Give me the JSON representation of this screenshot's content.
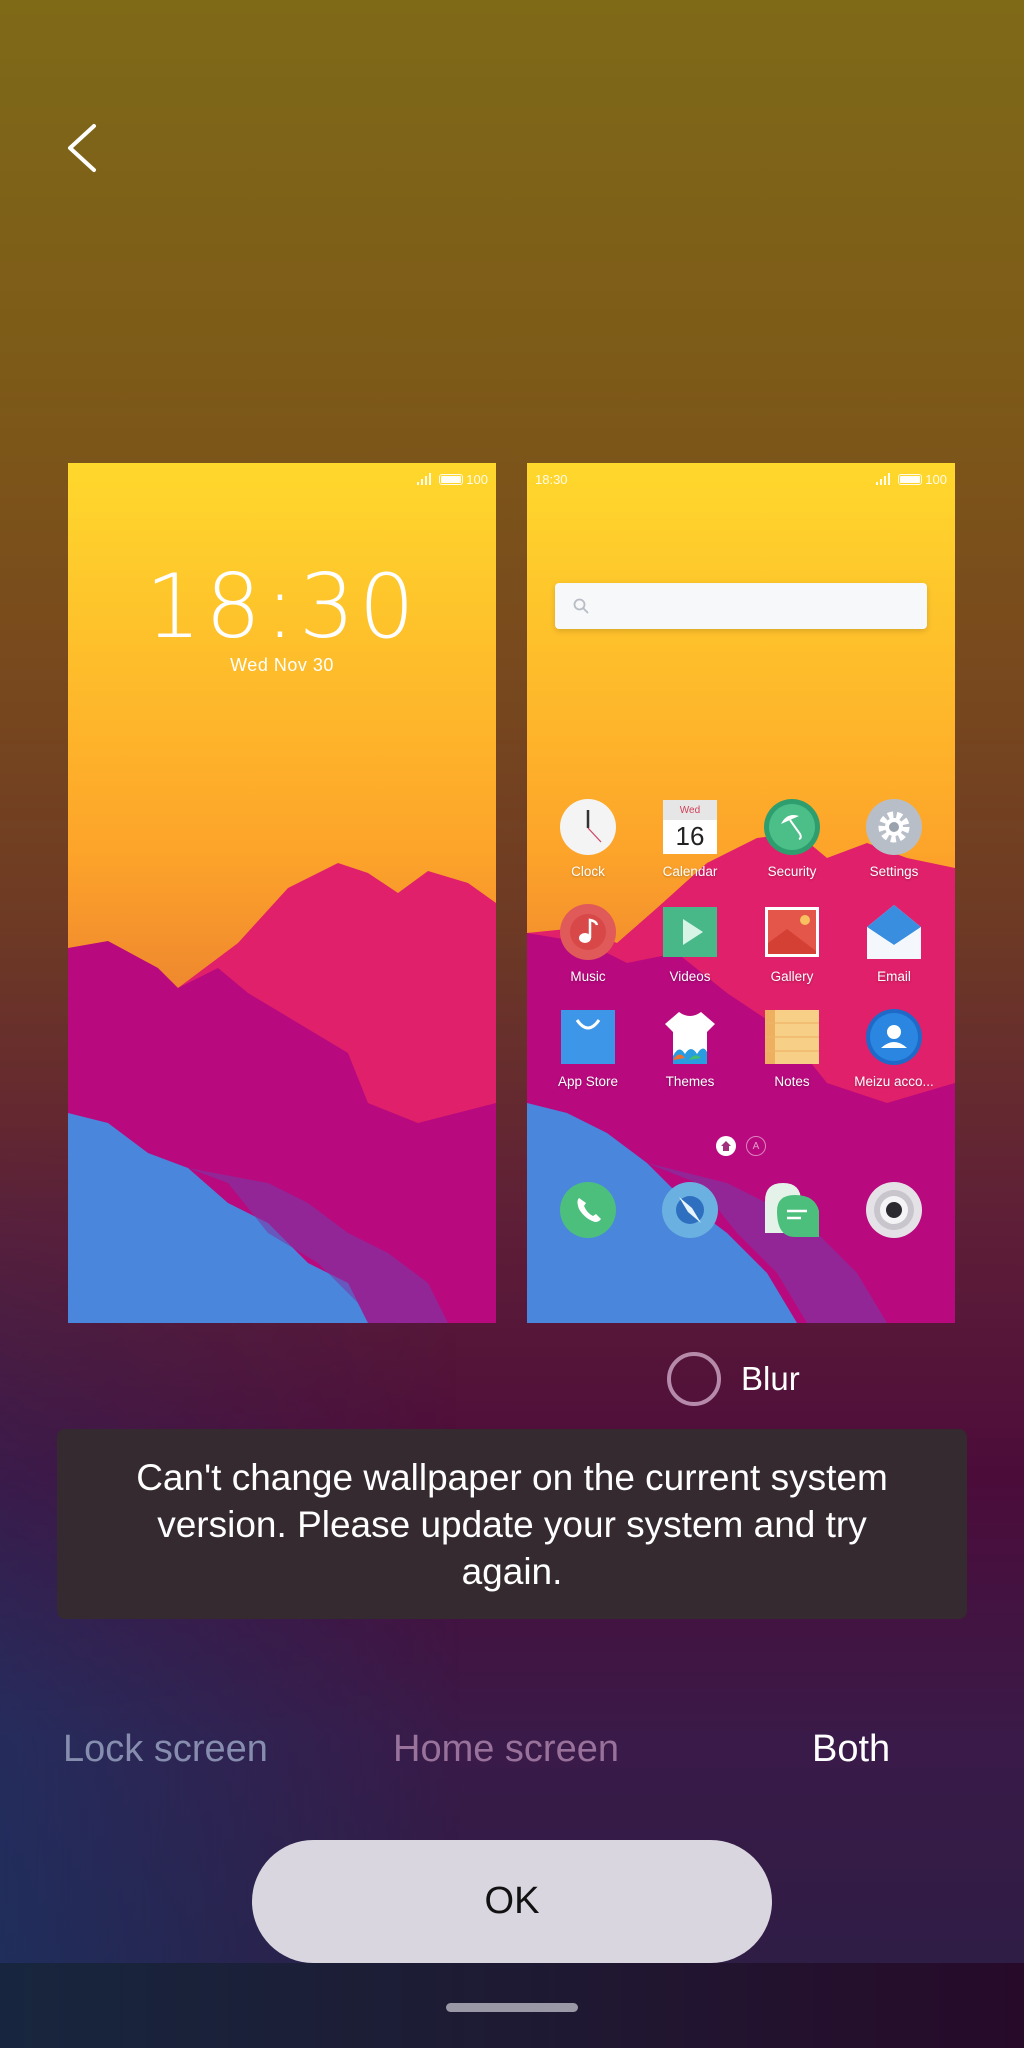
{
  "header": {
    "back_icon": "chevron-left-icon"
  },
  "lock_preview": {
    "status": {
      "signal_icon": "signal-icon",
      "battery_icon": "battery-icon",
      "battery_level": "100"
    },
    "time": "18:30",
    "date": "Wed  Nov 30"
  },
  "home_preview": {
    "status": {
      "time": "18:30",
      "signal_icon": "signal-icon",
      "battery_icon": "battery-icon",
      "battery_level": "100"
    },
    "search_icon": "search-icon",
    "apps": [
      {
        "label": "Clock",
        "icon": "clock-icon"
      },
      {
        "label": "Calendar",
        "icon": "calendar-icon",
        "cal_day": "Wed",
        "cal_date": "16"
      },
      {
        "label": "Security",
        "icon": "umbrella-shield-icon"
      },
      {
        "label": "Settings",
        "icon": "gear-icon"
      },
      {
        "label": "Music",
        "icon": "music-note-icon"
      },
      {
        "label": "Videos",
        "icon": "play-icon"
      },
      {
        "label": "Gallery",
        "icon": "image-icon"
      },
      {
        "label": "Email",
        "icon": "envelope-icon"
      },
      {
        "label": "App Store",
        "icon": "shopping-bag-icon"
      },
      {
        "label": "Themes",
        "icon": "tshirt-icon"
      },
      {
        "label": "Notes",
        "icon": "notepad-icon"
      },
      {
        "label": "Meizu acco...",
        "icon": "user-account-icon"
      }
    ],
    "page_indicators": [
      {
        "icon": "home-page-indicator-icon",
        "active": true
      },
      {
        "label": "A",
        "icon": "app-page-indicator-icon",
        "active": false
      }
    ],
    "dock": [
      {
        "icon": "phone-icon",
        "name": "Phone"
      },
      {
        "icon": "compass-browser-icon",
        "name": "Browser"
      },
      {
        "icon": "messages-icon",
        "name": "Messages"
      },
      {
        "icon": "camera-icon",
        "name": "Camera"
      }
    ]
  },
  "blur": {
    "label": "Blur",
    "checked": false
  },
  "toast": {
    "message": "Can't change wallpaper on the current system version. Please update your system and try again."
  },
  "apply_tabs": [
    {
      "label": "Lock screen",
      "selected": false
    },
    {
      "label": "Home screen",
      "selected": false
    },
    {
      "label": "Both",
      "selected": true
    }
  ],
  "ok_button": {
    "label": "OK"
  },
  "colors": {
    "toast_bg": "#352a30",
    "ok_bg": "#d9d6e0",
    "tab_selected": "#ffffff"
  }
}
